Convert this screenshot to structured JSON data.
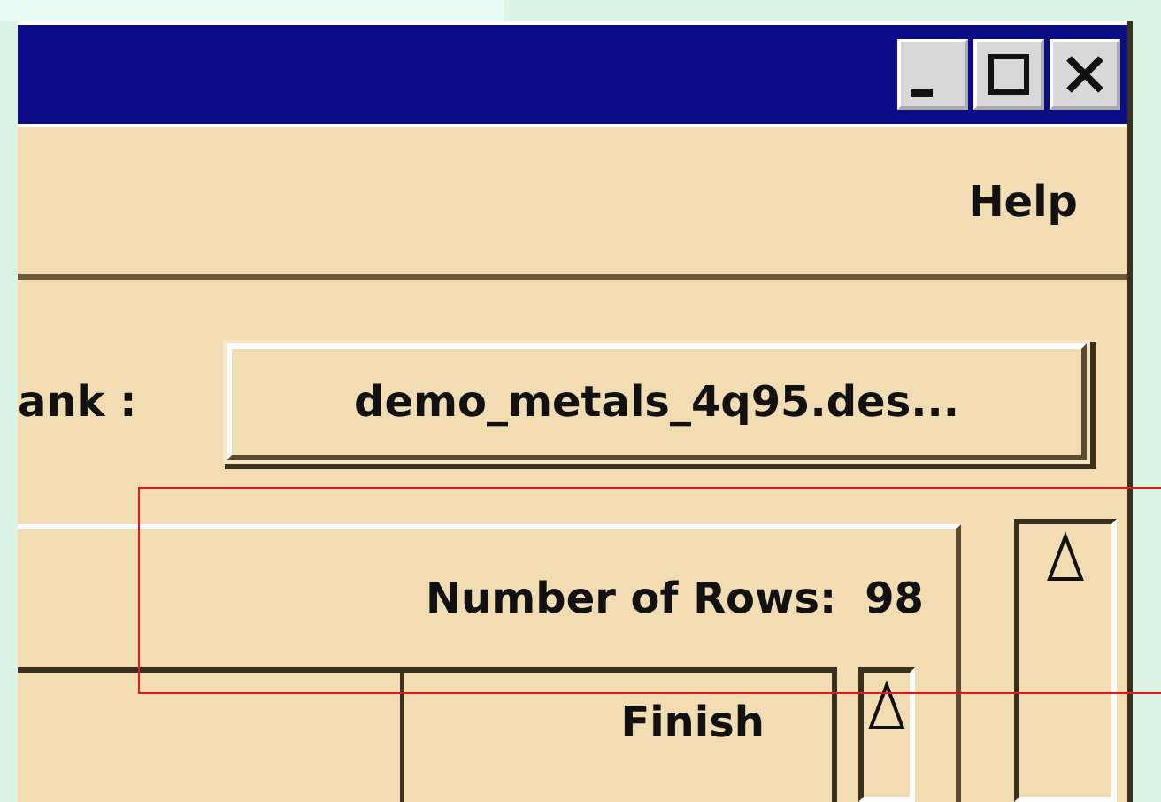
{
  "menu": {
    "items": [
      "Help"
    ]
  },
  "bank": {
    "label": "ank :",
    "file_button": "demo_metals_4q95.des..."
  },
  "summary": {
    "label": "Number of Rows:",
    "value": "98"
  },
  "table": {
    "columns": [
      "",
      "Finish"
    ]
  }
}
